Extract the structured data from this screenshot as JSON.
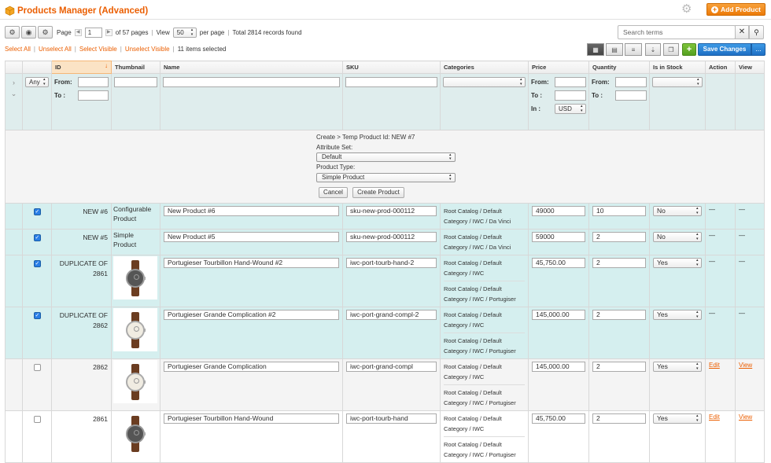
{
  "header": {
    "title": "Products Manager (Advanced)",
    "add_label": "Add Product"
  },
  "toolbar": {
    "page_label": "Page",
    "page_value": "1",
    "page_total": "of 57 pages",
    "view_label": "View",
    "view_value": "50",
    "per_page": "per page",
    "total": "Total 2814 records found",
    "search_placeholder": "Search terms",
    "clear": "✕",
    "go": "⌕"
  },
  "selection": {
    "select_all": "Select All",
    "unselect_all": "Unselect All",
    "select_visible": "Select Visible",
    "unselect_visible": "Unselect Visible",
    "count": "11 items selected"
  },
  "actions": {
    "save": "Save Changes",
    "more": "..."
  },
  "columns": {
    "id": "ID",
    "thumb": "Thumbnail",
    "name": "Name",
    "sku": "SKU",
    "categories": "Categories",
    "price": "Price",
    "qty": "Quantity",
    "stock": "Is in Stock",
    "action": "Action",
    "view": "View"
  },
  "filter": {
    "any": "Any",
    "from": "From:",
    "to": "To :",
    "in": "In :",
    "currency": "USD"
  },
  "create": {
    "title": "Create > Temp Product Id: NEW #7",
    "attr_label": "Attribute Set:",
    "attr_value": "Default",
    "type_label": "Product Type:",
    "type_value": "Simple Product",
    "cancel": "Cancel",
    "create": "Create Product"
  },
  "rows": [
    {
      "checked": true,
      "id": "NEW #6",
      "type": "Configurable Product",
      "name": "New Product #6",
      "sku": "sku-new-prod-000112",
      "cats": [
        "Root Catalog / Default Category / IWC / Da Vinci"
      ],
      "price": "49000",
      "qty": "10",
      "stock": "No",
      "action": "—",
      "view": "—"
    },
    {
      "checked": true,
      "id": "NEW #5",
      "type": "Simple Product",
      "name": "New Product #5",
      "sku": "sku-new-prod-000112",
      "cats": [
        "Root Catalog / Default Category / IWC / Da Vinci"
      ],
      "price": "59000",
      "qty": "2",
      "stock": "No",
      "action": "—",
      "view": "—"
    },
    {
      "checked": true,
      "id": "DUPLICATE OF 2861",
      "type": "",
      "name": "Portugieser Tourbillon Hand-Wound #2",
      "sku": "iwc-port-tourb-hand-2",
      "cats": [
        "Root Catalog / Default Category / IWC",
        "Root Catalog / Default Category / IWC / Portugiser"
      ],
      "price": "45,750.00",
      "qty": "2",
      "stock": "Yes",
      "action": "—",
      "view": "—"
    },
    {
      "checked": true,
      "id": "DUPLICATE OF 2862",
      "type": "",
      "name": "Portugieser Grande Complication #2",
      "sku": "iwc-port-grand-compl-2",
      "cats": [
        "Root Catalog / Default Category / IWC",
        "Root Catalog / Default Category / IWC / Portugiser"
      ],
      "price": "145,000.00",
      "qty": "2",
      "stock": "Yes",
      "action": "—",
      "view": "—"
    },
    {
      "checked": false,
      "id": "2862",
      "type": "",
      "name": "Portugieser Grande Complication",
      "sku": "iwc-port-grand-compl",
      "cats": [
        "Root Catalog / Default Category / IWC",
        "Root Catalog / Default Category / IWC / Portugiser"
      ],
      "price": "145,000.00",
      "qty": "2",
      "stock": "Yes",
      "action": "Edit",
      "view": "View"
    },
    {
      "checked": false,
      "id": "2861",
      "type": "",
      "name": "Portugieser Tourbillon Hand-Wound",
      "sku": "iwc-port-tourb-hand",
      "cats": [
        "Root Catalog / Default Category / IWC",
        "Root Catalog / Default Category / IWC / Portugiser"
      ],
      "price": "45,750.00",
      "qty": "2",
      "stock": "Yes",
      "action": "Edit",
      "view": "View"
    }
  ]
}
